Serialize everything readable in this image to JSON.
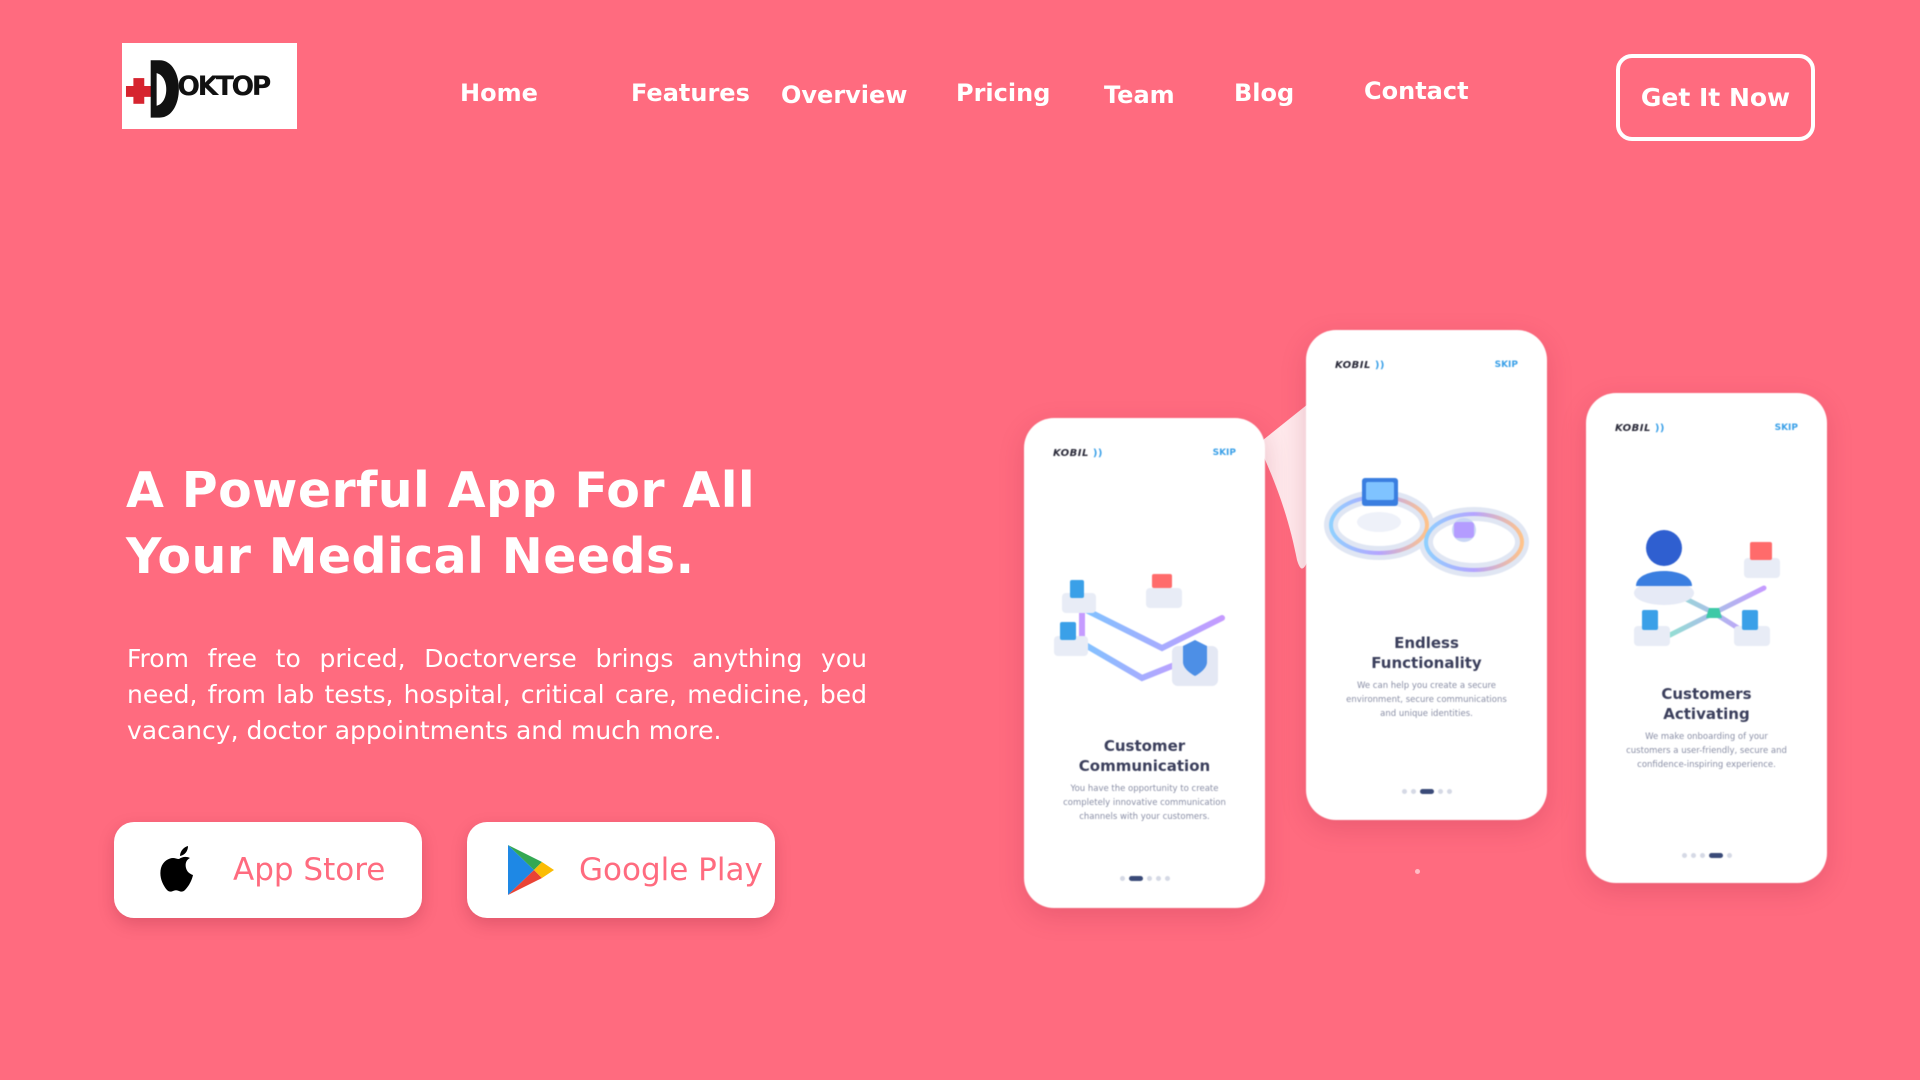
{
  "brand": {
    "logo_text": "OKTOP"
  },
  "nav": {
    "items": [
      {
        "label": "Home"
      },
      {
        "label": "Features"
      },
      {
        "label": "Overview"
      },
      {
        "label": "Pricing"
      },
      {
        "label": "Team"
      },
      {
        "label": "Blog"
      },
      {
        "label": "Contact"
      }
    ],
    "cta_label": "Get It Now"
  },
  "hero": {
    "title_line1": "A Powerful App For All",
    "title_line2": "Your Medical Needs.",
    "description": "From free to priced, Doctorverse brings anything you need, from lab tests, hospital, critical care, medicine, bed vacancy, doctor appointments and much more."
  },
  "store_buttons": {
    "apple": {
      "label": "App Store",
      "icon": "apple-icon"
    },
    "google": {
      "label": "Google Play",
      "icon": "google-play-icon"
    }
  },
  "phones": [
    {
      "brand": "KOBIL",
      "skip": "SKIP",
      "title": "Customer Communication",
      "text": "You have the opportunity to create completely innovative communication channels with your customers.",
      "active_dot": 1
    },
    {
      "brand": "KOBIL",
      "skip": "SKIP",
      "title": "Endless Functionality",
      "text": "We can help you create a secure environment, secure communications and unique identities.",
      "active_dot": 2
    },
    {
      "brand": "KOBIL",
      "skip": "SKIP",
      "title": "Customers Activating",
      "text": "We make onboarding of your customers a user-friendly, secure and confidence-inspiring experience.",
      "active_dot": 3
    }
  ],
  "colors": {
    "background": "#ff6b7f",
    "text": "#ffffff",
    "button_label": "#ff6b7f",
    "logo_cross": "#d6242f"
  }
}
